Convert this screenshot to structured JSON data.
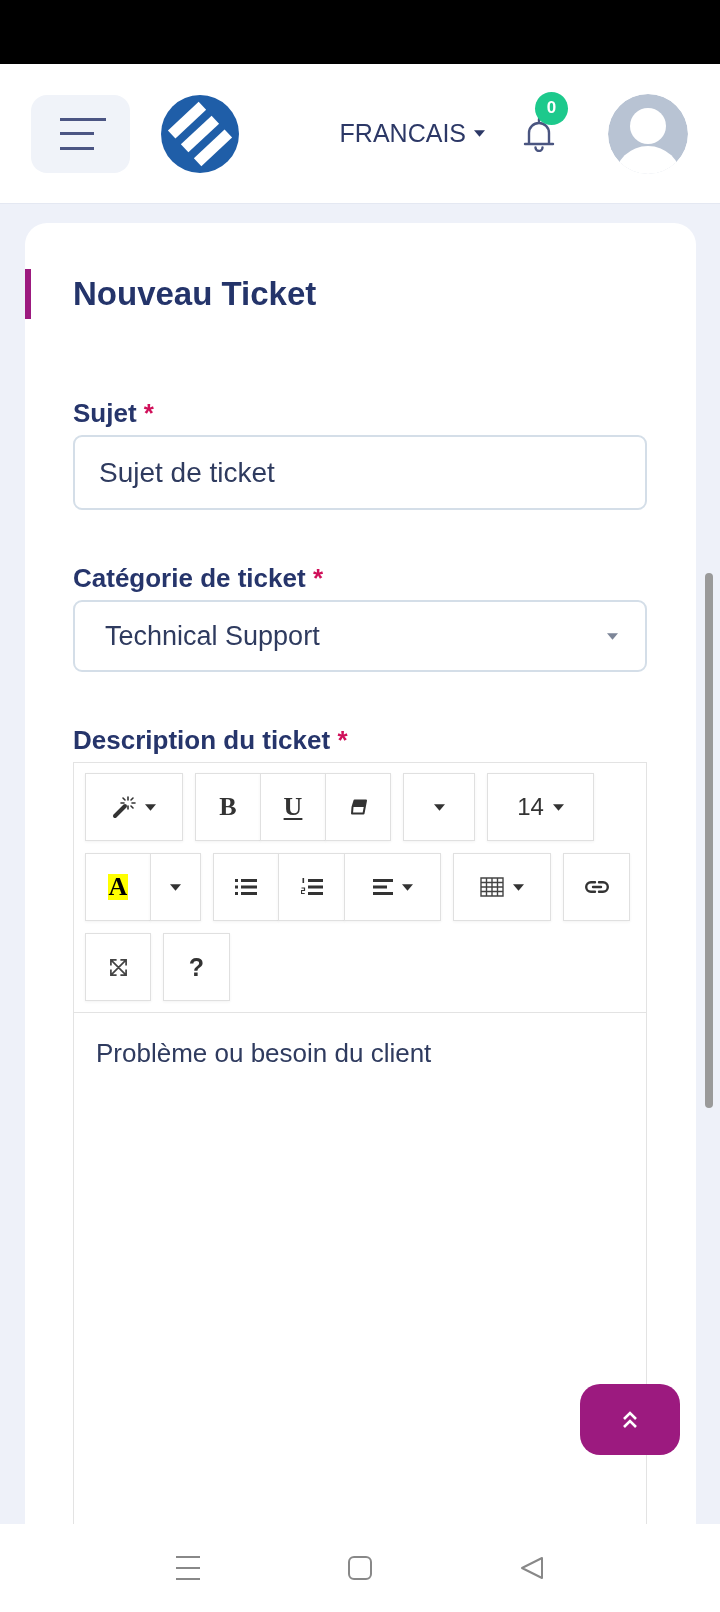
{
  "header": {
    "language": "FRANCAIS",
    "notification_count": "0"
  },
  "form": {
    "title": "Nouveau Ticket",
    "fields": [
      {
        "kind": "text",
        "label": "Sujet",
        "required_mark": "*",
        "placeholder": "Sujet de ticket"
      },
      {
        "kind": "select",
        "label": "Catégorie de ticket",
        "required_mark": "*",
        "value": "Technical Support"
      },
      {
        "kind": "editor",
        "label": "Description du ticket",
        "required_mark": "*",
        "placeholder": "Problème ou besoin du client",
        "toolbar": [
          [
            {
              "kind": "style",
              "dropdown": true
            }
          ],
          [
            {
              "kind": "bold",
              "label": "B",
              "dropdown": false
            },
            {
              "kind": "underline",
              "label": "U",
              "dropdown": false
            },
            {
              "kind": "eraser",
              "dropdown": false
            }
          ],
          [
            {
              "kind": "font",
              "dropdown": true
            }
          ],
          [
            {
              "kind": "size",
              "label": "14",
              "dropdown": true
            }
          ],
          [
            {
              "kind": "color",
              "label": "A",
              "dropdown": false
            },
            {
              "kind": "color_menu",
              "dropdown": true
            }
          ],
          [
            {
              "kind": "ul",
              "dropdown": false
            },
            {
              "kind": "ol",
              "dropdown": false
            },
            {
              "kind": "align",
              "dropdown": true
            }
          ],
          [
            {
              "kind": "table",
              "dropdown": true
            }
          ],
          [
            {
              "kind": "link",
              "dropdown": false
            }
          ],
          [
            {
              "kind": "fullscreen",
              "dropdown": false
            }
          ],
          [
            {
              "kind": "help",
              "label": "?",
              "dropdown": false
            }
          ]
        ]
      }
    ]
  }
}
